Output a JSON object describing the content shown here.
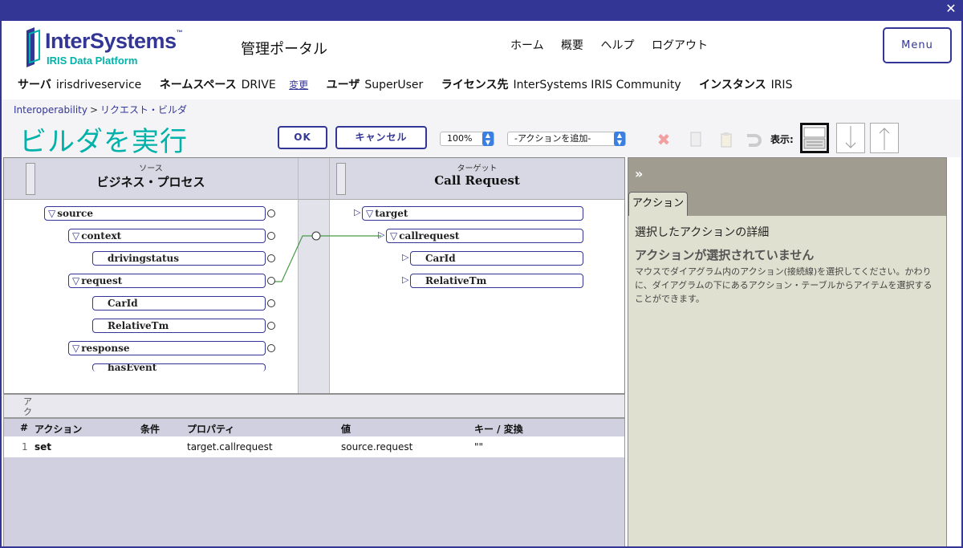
{
  "window": {
    "close_glyph": "✕"
  },
  "logo": {
    "name": "InterSystems",
    "tm": "™",
    "sub": "IRIS Data Platform",
    "brand_color": "#333695",
    "accent_color": "#00b2a9"
  },
  "header": {
    "portal_title": "管理ポータル",
    "nav": [
      "ホーム",
      "概要",
      "ヘルプ",
      "ログアウト"
    ],
    "menu_label": "Menu"
  },
  "info": {
    "server_label": "サーバ",
    "server_value": "irisdriveservice",
    "namespace_label": "ネームスペース",
    "namespace_value": "DRIVE",
    "change_link": "変更",
    "user_label": "ユーザ",
    "user_value": "SuperUser",
    "license_label": "ライセンス先",
    "license_value": "InterSystems IRIS Community",
    "instance_label": "インスタンス",
    "instance_value": "IRIS"
  },
  "breadcrumb": {
    "parent": "Interoperability",
    "sep": ">",
    "current": "リクエスト・ビルダ"
  },
  "page_title": "ビルダを実行",
  "toolbar": {
    "ok_label": "OK",
    "cancel_label": "キャンセル",
    "zoom_value": "100%",
    "add_action_value": "-アクションを追加-",
    "show_label": "表示:",
    "icons": [
      "delete-icon",
      "copy-icon",
      "paste-icon",
      "undo-icon"
    ]
  },
  "source": {
    "small": "ソース",
    "title": "ビジネス・プロセス",
    "nodes": [
      "source",
      "context",
      "drivingstatus",
      "request",
      "CarId",
      "RelativeTm",
      "response",
      "hasEvent"
    ]
  },
  "target": {
    "small": "ターゲット",
    "title": "Call Request",
    "nodes": [
      "target",
      "callrequest",
      "CarId",
      "RelativeTm"
    ]
  },
  "actions": {
    "section_label": "アクション",
    "columns": [
      "#",
      "アクション",
      "条件",
      "プロパティ",
      "値",
      "キー / 変換"
    ],
    "rows": [
      {
        "num": "1",
        "action": "set",
        "condition": "",
        "property": "target.callrequest",
        "value": "source.request",
        "key": "\"\""
      }
    ]
  },
  "details": {
    "expand_glyph": "»",
    "tab_label": "アクション",
    "heading": "選択したアクションの詳細",
    "none_selected": "アクションが選択されていません",
    "help_text": "マウスでダイアグラム内のアクション(接続線)を選択してください。かわりに、ダイアグラムの下にあるアクション・テーブルからアイテムを選択することができます。"
  }
}
